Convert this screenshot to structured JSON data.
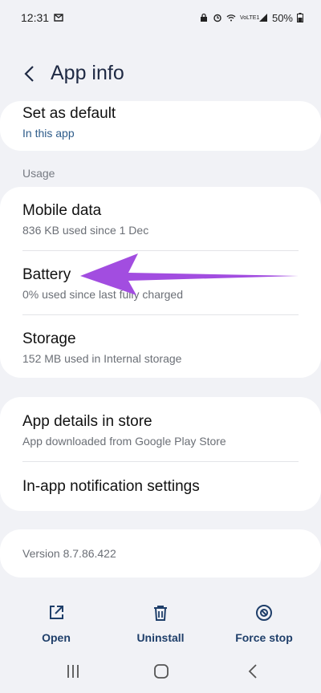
{
  "status_bar": {
    "time": "12:31",
    "network_label": "VoLTE1",
    "battery": "50%"
  },
  "header": {
    "title": "App info"
  },
  "set_as_default": {
    "title": "Set as default",
    "subtitle": "In this app"
  },
  "usage_section": {
    "label": "Usage",
    "items": [
      {
        "title": "Mobile data",
        "subtitle": "836 KB used since 1 Dec"
      },
      {
        "title": "Battery",
        "subtitle": "0% used since last fully charged"
      },
      {
        "title": "Storage",
        "subtitle": "152 MB used in Internal storage"
      }
    ]
  },
  "store_section": {
    "items": [
      {
        "title": "App details in store",
        "subtitle": "App downloaded from Google Play Store"
      },
      {
        "title": "In-app notification settings"
      }
    ]
  },
  "version": "Version 8.7.86.422",
  "actions": {
    "open": "Open",
    "uninstall": "Uninstall",
    "force_stop": "Force stop"
  },
  "colors": {
    "accent": "#1f3f6a",
    "background": "#f1f2f6",
    "arrow": "#a24de0"
  }
}
